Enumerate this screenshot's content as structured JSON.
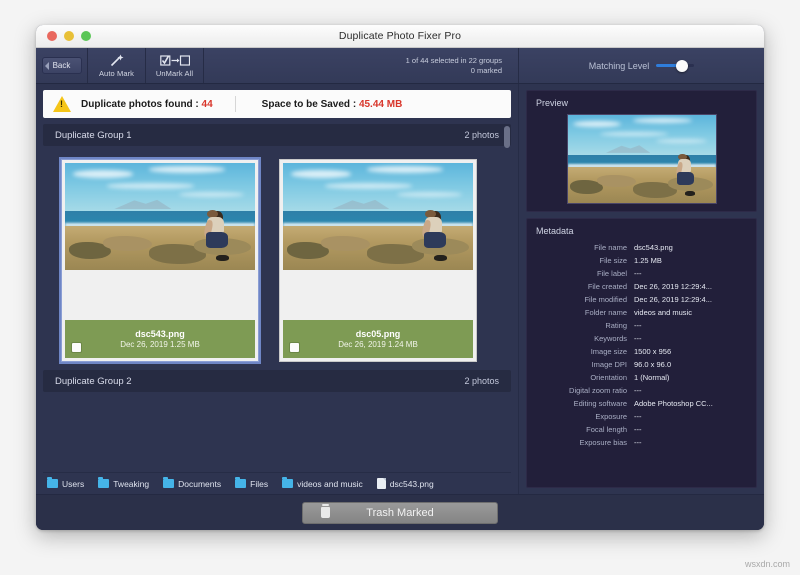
{
  "window": {
    "title": "Duplicate Photo Fixer Pro",
    "traffic_lights": [
      "close-red",
      "minimize-yellow",
      "zoom-green"
    ]
  },
  "toolbar": {
    "back_label": "Back",
    "auto_mark_label": "Auto Mark",
    "unmark_all_label": "UnMark All",
    "status_line_1": "1 of 44 selected in 22 groups",
    "status_line_2": "0 marked",
    "matching_level_label": "Matching Level",
    "matching_level_accent": "#2f7ddb"
  },
  "found_bar": {
    "icon": "warning-triangle-icon",
    "duplicates_label": "Duplicate photos found : ",
    "duplicates_count": "44",
    "space_label": "Space to be Saved : ",
    "space_value": "45.44 MB",
    "highlight_color": "#d8352a"
  },
  "groups": [
    {
      "title": "Duplicate Group 1",
      "count_label": "2 photos",
      "photos": [
        {
          "name": "dsc543.png",
          "detail": "Dec 26, 2019 1.25 MB",
          "selected": true,
          "checked": false
        },
        {
          "name": "dsc05.png",
          "detail": "Dec 26, 2019 1.24 MB",
          "selected": false,
          "checked": false
        }
      ]
    },
    {
      "title": "Duplicate Group 2",
      "count_label": "2 photos",
      "photos": []
    }
  ],
  "pathbar": [
    {
      "label": "Users",
      "icon": "folder-icon"
    },
    {
      "label": "Tweaking",
      "icon": "folder-icon"
    },
    {
      "label": "Documents",
      "icon": "folder-icon"
    },
    {
      "label": "Files",
      "icon": "folder-icon"
    },
    {
      "label": "videos and music",
      "icon": "folder-icon"
    },
    {
      "label": "dsc543.png",
      "icon": "file-icon"
    }
  ],
  "preview": {
    "title": "Preview"
  },
  "metadata": {
    "title": "Metadata",
    "rows": [
      {
        "key": "File name",
        "value": "dsc543.png"
      },
      {
        "key": "File size",
        "value": "1.25 MB"
      },
      {
        "key": "File label",
        "value": "---"
      },
      {
        "key": "File created",
        "value": "Dec 26, 2019 12:29:4..."
      },
      {
        "key": "File modified",
        "value": "Dec 26, 2019 12:29:4..."
      },
      {
        "key": "Folder name",
        "value": "videos and music"
      },
      {
        "key": "Rating",
        "value": "---"
      },
      {
        "key": "Keywords",
        "value": "---"
      },
      {
        "key": "Image size",
        "value": "1500 x 956"
      },
      {
        "key": "Image DPI",
        "value": "96.0 x 96.0"
      },
      {
        "key": "Orientation",
        "value": "1 (Normal)"
      },
      {
        "key": "Digital zoom ratio",
        "value": "---"
      },
      {
        "key": "Editing software",
        "value": "Adobe Photoshop CC..."
      },
      {
        "key": "Exposure",
        "value": "---"
      },
      {
        "key": "Focal length",
        "value": "---"
      },
      {
        "key": "Exposure bias",
        "value": "---"
      }
    ]
  },
  "footer": {
    "trash_label": "Trash Marked",
    "trash_icon": "trash-icon"
  },
  "watermark": "wsxdn.com"
}
